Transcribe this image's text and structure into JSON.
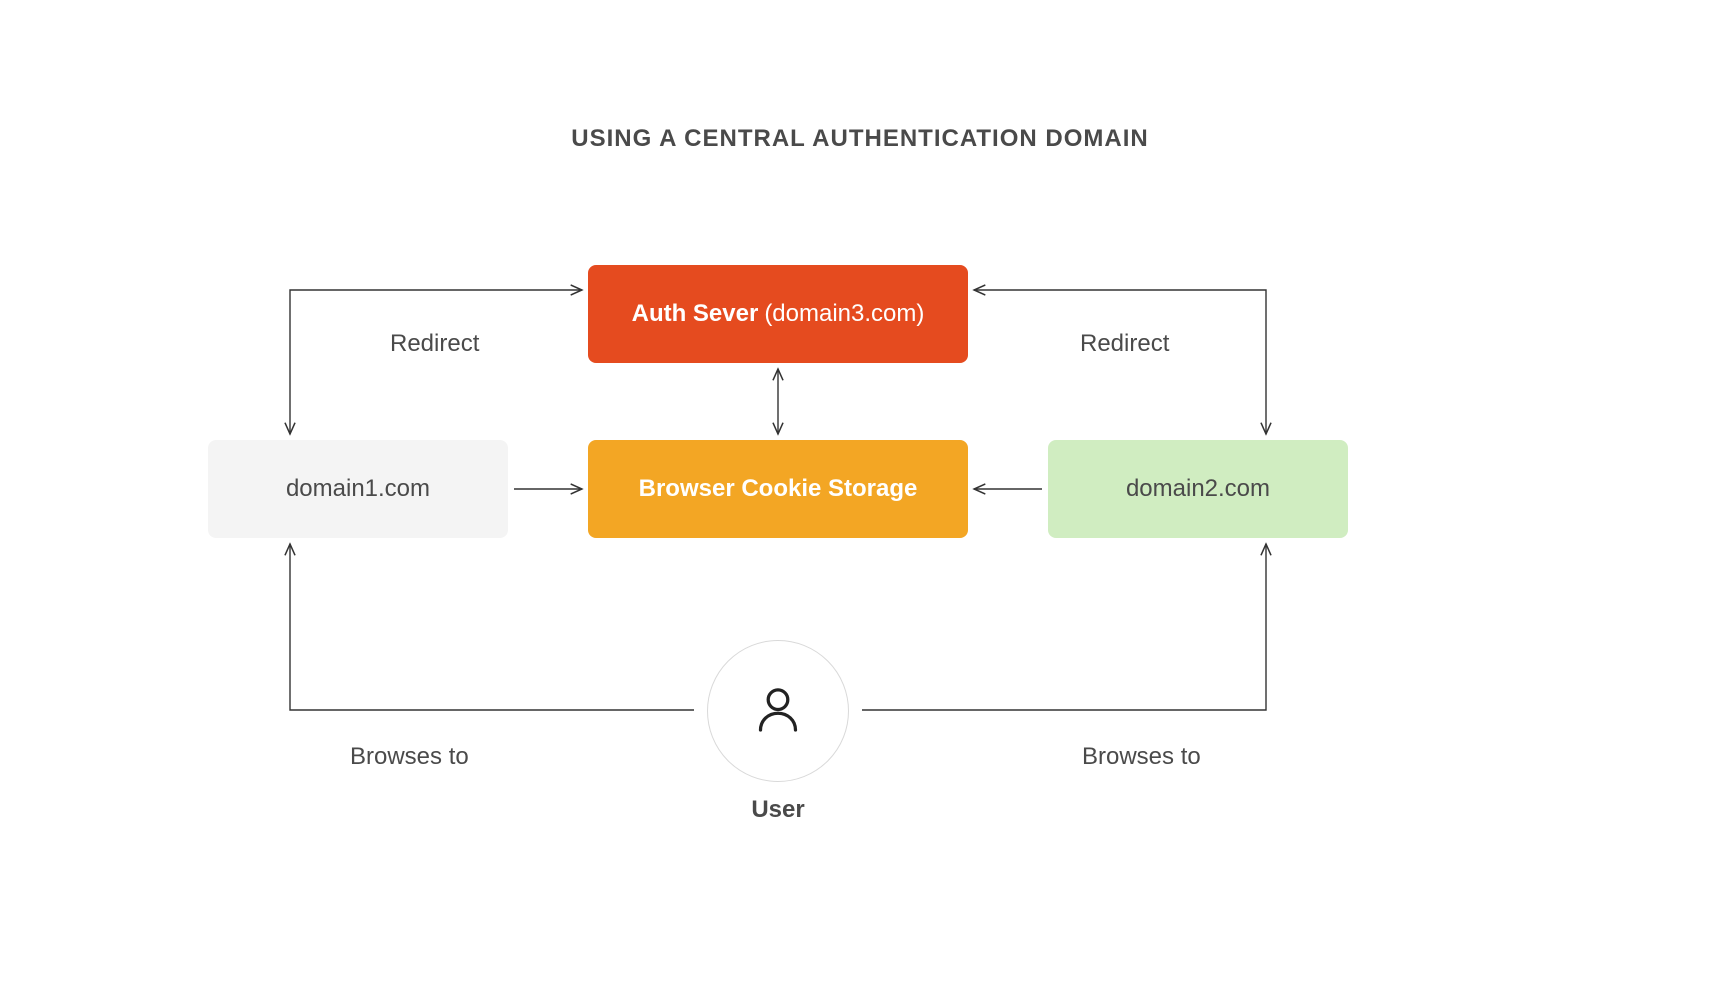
{
  "title": "USING A CENTRAL AUTHENTICATION DOMAIN",
  "nodes": {
    "auth": {
      "label_strong": "Auth Sever",
      "label_rest": "(domain3.com)"
    },
    "cookie": {
      "label": "Browser Cookie Storage"
    },
    "domain1": {
      "label": "domain1.com"
    },
    "domain2": {
      "label": "domain2.com"
    },
    "user": {
      "label": "User"
    }
  },
  "edges": {
    "redirect_left": "Redirect",
    "redirect_right": "Redirect",
    "browses_left": "Browses to",
    "browses_right": "Browses to"
  },
  "colors": {
    "auth": "#E54B1F",
    "cookie": "#F3A624",
    "domain1": "#F4F4F4",
    "domain2": "#D0EDC1",
    "arrow": "#333333"
  }
}
